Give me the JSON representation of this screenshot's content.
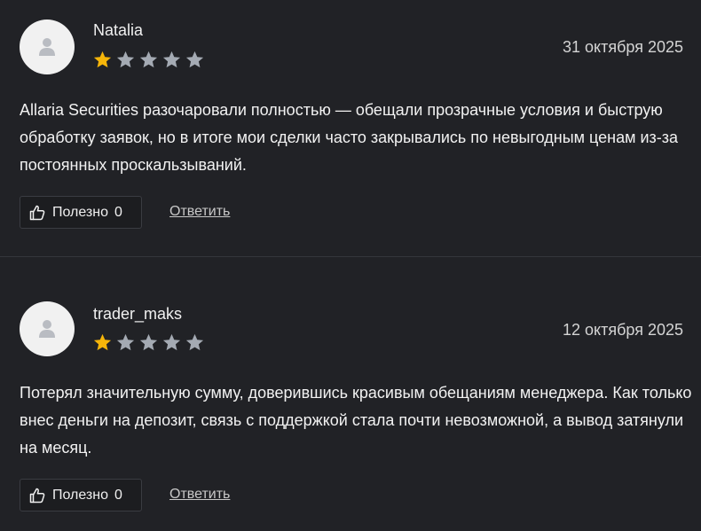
{
  "reviews": [
    {
      "author": "Natalia",
      "date": "31 октября 2025",
      "rating": 1,
      "rating_max": 5,
      "text": "Allaria Securities разочаровали полностью — обещали прозрачные условия и быструю обработку заявок, но в итоге мои сделки часто закрывались по невыгодным ценам из-за постоянных проскальзываний.",
      "helpful_label": "Полезно",
      "helpful_count": "0",
      "reply_label": "Ответить"
    },
    {
      "author": "trader_maks",
      "date": "12 октября 2025",
      "rating": 1,
      "rating_max": 5,
      "text": "Потерял значительную сумму, доверившись красивым обещаниям менеджера. Как только внес деньги на депозит, связь с поддержкой стала почти невозможной, а вывод затянули на месяц.",
      "helpful_label": "Полезно",
      "helpful_count": "0",
      "reply_label": "Ответить"
    }
  ],
  "colors": {
    "background": "#212226",
    "star_filled": "#f5b50a",
    "star_empty": "#a4aab3"
  },
  "icons": {
    "avatar": "user-icon",
    "rating": "star-icon",
    "helpful": "thumbs-up-icon"
  }
}
